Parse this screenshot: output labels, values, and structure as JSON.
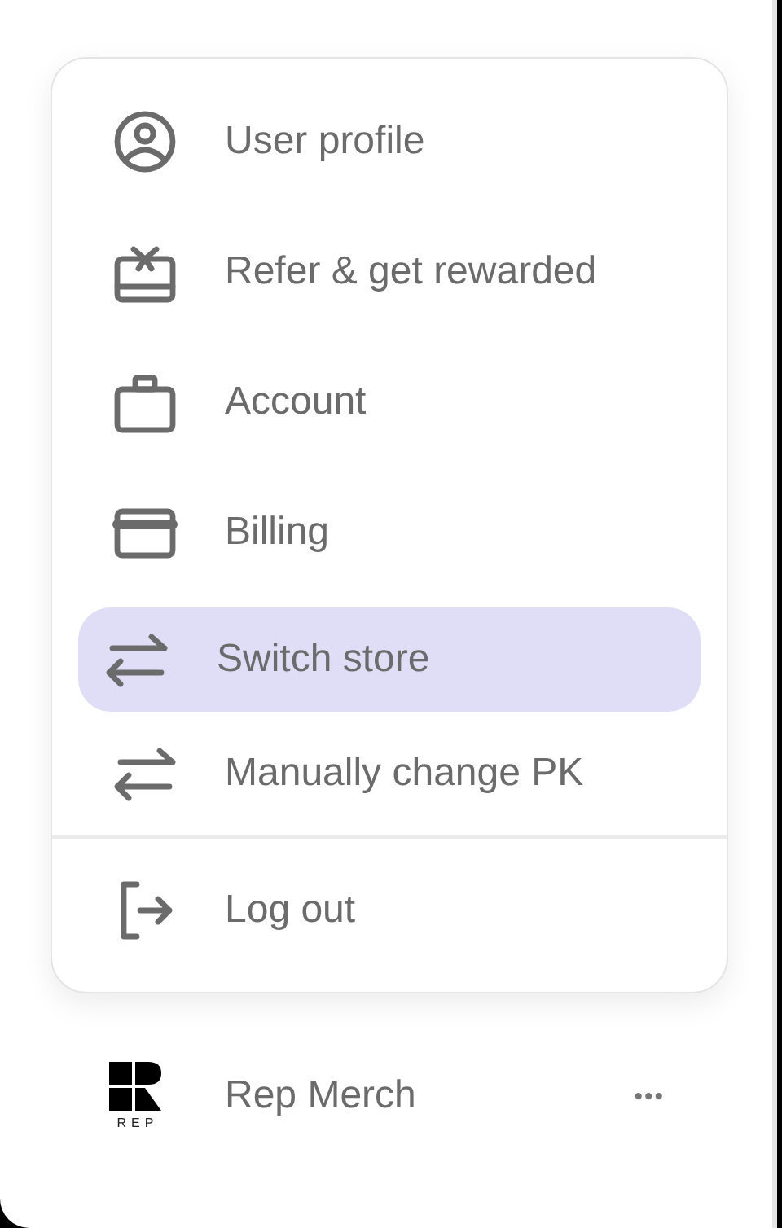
{
  "menu": {
    "items": [
      {
        "label": "User profile",
        "kind": "user",
        "selected": false
      },
      {
        "label": "Refer & get rewarded",
        "kind": "gift",
        "selected": false
      },
      {
        "label": "Account",
        "kind": "briefcase",
        "selected": false
      },
      {
        "label": "Billing",
        "kind": "card",
        "selected": false
      },
      {
        "label": "Switch store",
        "kind": "switch",
        "selected": true
      },
      {
        "label": "Manually change PK",
        "kind": "switch",
        "selected": false
      }
    ],
    "footer_items": [
      {
        "label": "Log out",
        "kind": "logout",
        "selected": false
      }
    ]
  },
  "store": {
    "logo_text": "REP",
    "name": "Rep Merch",
    "more": "•••"
  }
}
